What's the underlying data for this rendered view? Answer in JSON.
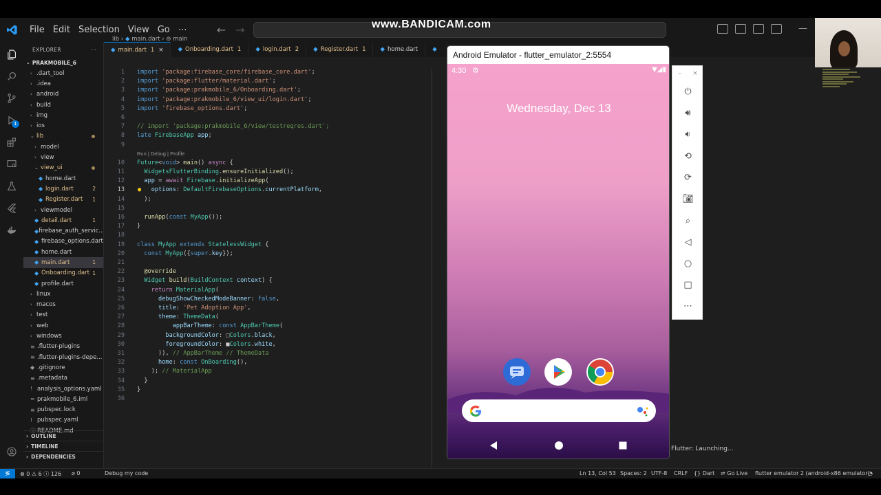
{
  "watermark": "www.BANDICAM.com",
  "menu": [
    "File",
    "Edit",
    "Selection",
    "View",
    "Go",
    "⋯"
  ],
  "explorer": {
    "title": "EXPLORER",
    "project": "PRAKMOBILE_6",
    "items": [
      {
        "label": ".dart_tool",
        "indent": 1,
        "chev": "›"
      },
      {
        "label": ".idea",
        "indent": 1,
        "chev": "›"
      },
      {
        "label": "android",
        "indent": 1,
        "chev": "›"
      },
      {
        "label": "build",
        "indent": 1,
        "chev": "›"
      },
      {
        "label": "img",
        "indent": 1,
        "chev": "›"
      },
      {
        "label": "ios",
        "indent": 1,
        "chev": "›"
      },
      {
        "label": "lib",
        "indent": 1,
        "chev": "⌄",
        "yellow": true,
        "dot": true
      },
      {
        "label": "model",
        "indent": 2,
        "chev": "›"
      },
      {
        "label": "view",
        "indent": 2,
        "chev": "›"
      },
      {
        "label": "view_ui",
        "indent": 2,
        "chev": "⌄",
        "yellow": true,
        "dot": true
      },
      {
        "label": "home.dart",
        "indent": 3,
        "dart": true
      },
      {
        "label": "login.dart",
        "indent": 3,
        "dart": true,
        "yellow": true,
        "count": "2"
      },
      {
        "label": "Register.dart",
        "indent": 3,
        "dart": true,
        "yellow": true,
        "count": "1"
      },
      {
        "label": "viewmodel",
        "indent": 2,
        "chev": "›"
      },
      {
        "label": "detail.dart",
        "indent": 2,
        "dart": true,
        "yellow": true,
        "count": "1"
      },
      {
        "label": "firebase_auth_servic...",
        "indent": 2,
        "dart": true
      },
      {
        "label": "firebase_options.dart",
        "indent": 2,
        "dart": true
      },
      {
        "label": "home.dart",
        "indent": 2,
        "dart": true
      },
      {
        "label": "main.dart",
        "indent": 2,
        "dart": true,
        "yellow": true,
        "count": "1",
        "selected": true
      },
      {
        "label": "Onboarding.dart",
        "indent": 2,
        "dart": true,
        "yellow": true,
        "count": "1"
      },
      {
        "label": "profile.dart",
        "indent": 2,
        "dart": true
      },
      {
        "label": "linux",
        "indent": 1,
        "chev": "›"
      },
      {
        "label": "macos",
        "indent": 1,
        "chev": "›"
      },
      {
        "label": "test",
        "indent": 1,
        "chev": "›"
      },
      {
        "label": "web",
        "indent": 1,
        "chev": "›"
      },
      {
        "label": "windows",
        "indent": 1,
        "chev": "›"
      },
      {
        "label": ".flutter-plugins",
        "indent": 1,
        "file": "≡"
      },
      {
        "label": ".flutter-plugins-depe...",
        "indent": 1,
        "file": "≡"
      },
      {
        "label": ".gitignore",
        "indent": 1,
        "file": "◆"
      },
      {
        "label": ".metadata",
        "indent": 1,
        "file": "≡"
      },
      {
        "label": "analysis_options.yaml",
        "indent": 1,
        "file": "!"
      },
      {
        "label": "prakmobile_6.iml",
        "indent": 1,
        "file": "≈"
      },
      {
        "label": "pubspec.lock",
        "indent": 1,
        "file": "≡"
      },
      {
        "label": "pubspec.yaml",
        "indent": 1,
        "file": "!"
      },
      {
        "label": "README.md",
        "indent": 1,
        "file": "ⓘ"
      }
    ],
    "sections": [
      "OUTLINE",
      "TIMELINE",
      "DEPENDENCIES"
    ]
  },
  "tabs": [
    {
      "label": "main.dart",
      "count": "1",
      "active": true
    },
    {
      "label": "Onboarding.dart",
      "count": "1"
    },
    {
      "label": "login.dart",
      "count": "2"
    },
    {
      "label": "Register.dart",
      "count": "1"
    },
    {
      "label": "home.dart",
      "count": ""
    },
    {
      "label": "",
      "count": ""
    }
  ],
  "breadcrumb": {
    "folder": "lib",
    "file": "main.dart",
    "symbol": "main"
  },
  "codelens": "Run | Debug | Profile",
  "status": {
    "errors": "⊗ 0 ⚠ 6 ⓘ 126",
    "ports": "⌀ 0",
    "debug": "Debug my code",
    "position": "Ln 13, Col 53",
    "spaces": "Spaces: 2",
    "encoding": "UTF-8",
    "eol": "CRLF",
    "language": "{} Dart",
    "golive": "⇌ Go Live",
    "device": "flutter emulator 2 (android-x86 emulator)",
    "bell": "🔔"
  },
  "emulator": {
    "window_title": "Android Emulator - flutter_emulator_2:5554",
    "time": "4:30",
    "date": "Wednesday, Dec 13"
  },
  "toast": "Flutter: Launching..."
}
